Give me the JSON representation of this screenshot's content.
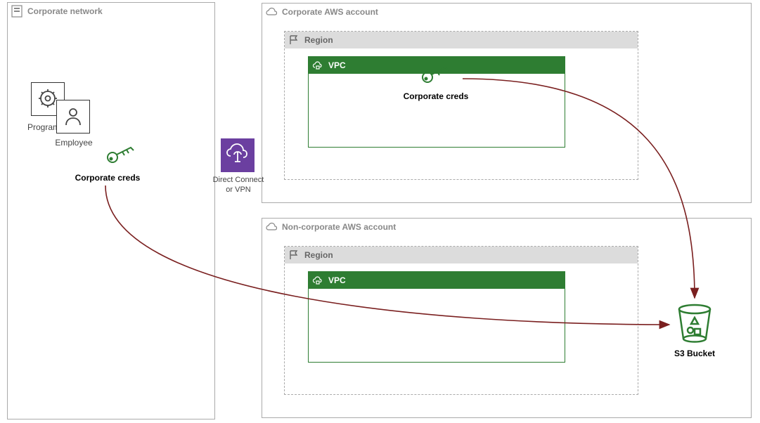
{
  "corporate_network": {
    "label": "Corporate network"
  },
  "program": {
    "label": "Program"
  },
  "employee": {
    "label": "Employee"
  },
  "corporate_creds_left": {
    "label": "Corporate creds"
  },
  "direct_connect": {
    "label_line1": "Direct Connect",
    "label_line2": "or VPN"
  },
  "corp_account": {
    "label": "Corporate AWS account"
  },
  "region1": {
    "label": "Region"
  },
  "vpc1": {
    "label": "VPC"
  },
  "corporate_creds_vpc": {
    "label": "Corporate creds"
  },
  "noncorp_account": {
    "label": "Non-corporate AWS account"
  },
  "region2": {
    "label": "Region"
  },
  "vpc2": {
    "label": "VPC"
  },
  "s3_bucket": {
    "label": "S3 Bucket"
  }
}
